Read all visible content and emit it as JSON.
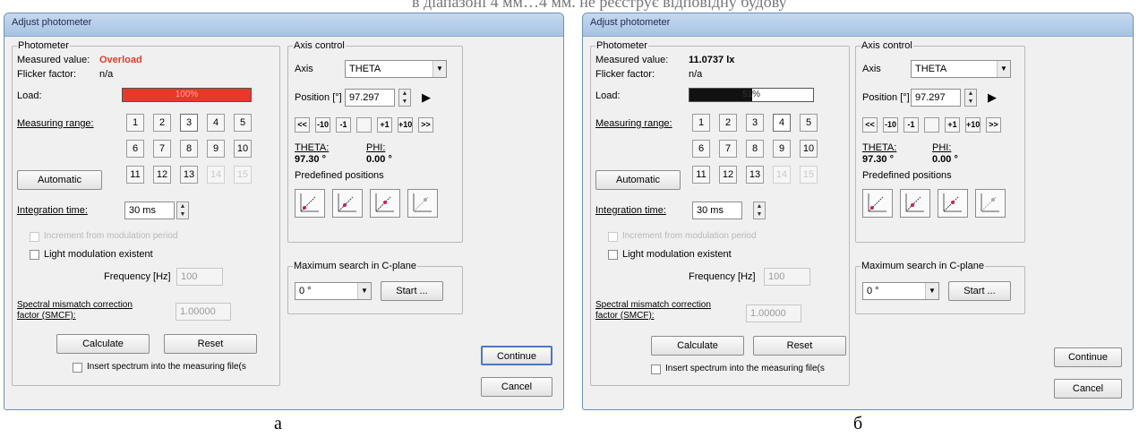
{
  "top_caption": "в діапазоні 4 мм…4 мм. не реєструє відповідну будову",
  "dialog_a": {
    "title": "Adjust photometer",
    "photometer_group": "Photometer",
    "measured_value_label": "Measured value:",
    "measured_value": "Overload",
    "flicker_label": "Flicker factor:",
    "flicker_value": "n/a",
    "load_label": "Load:",
    "load_text": "100%",
    "load_fraction": 1.0,
    "measuring_range_label": "Measuring range:",
    "ranges": [
      "1",
      "2",
      "3",
      "4",
      "5",
      "6",
      "7",
      "8",
      "9",
      "10",
      "11",
      "12",
      "13",
      "14",
      "15"
    ],
    "automatic_label": "Automatic",
    "integration_label": "Integration time:",
    "integration_value": "30 ms",
    "increment_label": "Increment from modulation period",
    "light_mod_label": "Light modulation existent",
    "frequency_label": "Frequency [Hz]",
    "frequency_value": "100",
    "smcf_label_1": "Spectral mismatch correction",
    "smcf_label_2": "factor (SMCF):",
    "smcf_value": "1.00000",
    "calculate_label": "Calculate",
    "reset_label": "Reset",
    "insert_label": "Insert spectrum into the measuring file(s",
    "axis_group": "Axis control",
    "axis_label": "Axis",
    "axis_value": "THETA",
    "position_label": "Position [°]",
    "position_value": "97.297",
    "step_buttons": [
      "<<",
      "-10",
      "-1",
      "",
      "+1",
      "+10",
      ">>"
    ],
    "theta_label": "THETA:",
    "theta_value": "97.30 °",
    "phi_label": "PHI:",
    "phi_value": "0.00 °",
    "predefined_label": "Predefined positions",
    "max_search_group": "Maximum search in C-plane",
    "max_search_value": "0 °",
    "start_label": "Start ...",
    "continue_label": "Continue",
    "cancel_label": "Cancel",
    "caption": "а",
    "load_color": "#e53a2b"
  },
  "dialog_b": {
    "title": "Adjust photometer",
    "photometer_group": "Photometer",
    "measured_value_label": "Measured value:",
    "measured_value": "11.0737 lx",
    "flicker_label": "Flicker factor:",
    "flicker_value": "n/a",
    "load_label": "Load:",
    "load_text": "51%",
    "load_fraction": 0.51,
    "measuring_range_label": "Measuring range:",
    "ranges": [
      "1",
      "2",
      "3",
      "4",
      "5",
      "6",
      "7",
      "8",
      "9",
      "10",
      "11",
      "12",
      "13",
      "14",
      "15"
    ],
    "automatic_label": "Automatic",
    "integration_label": "Integration time:",
    "integration_value": "30 ms",
    "increment_label": "Increment from modulation period",
    "light_mod_label": "Light modulation existent",
    "frequency_label": "Frequency [Hz]",
    "frequency_value": "100",
    "smcf_label_1": "Spectral mismatch correction",
    "smcf_label_2": "factor (SMCF):",
    "smcf_value": "1.00000",
    "calculate_label": "Calculate",
    "reset_label": "Reset",
    "insert_label": "Insert spectrum into the measuring file(s",
    "axis_group": "Axis control",
    "axis_label": "Axis",
    "axis_value": "THETA",
    "position_label": "Position [°]",
    "position_value": "97.297",
    "step_buttons": [
      "<<",
      "-10",
      "-1",
      "",
      "+1",
      "+10",
      ">>"
    ],
    "theta_label": "THETA:",
    "theta_value": "97.30 °",
    "phi_label": "PHI:",
    "phi_value": "0.00 °",
    "predefined_label": "Predefined positions",
    "max_search_group": "Maximum search in C-plane",
    "max_search_value": "0 °",
    "start_label": "Start ...",
    "continue_label": "Continue",
    "cancel_label": "Cancel",
    "caption": "б",
    "load_color": "#111111"
  }
}
